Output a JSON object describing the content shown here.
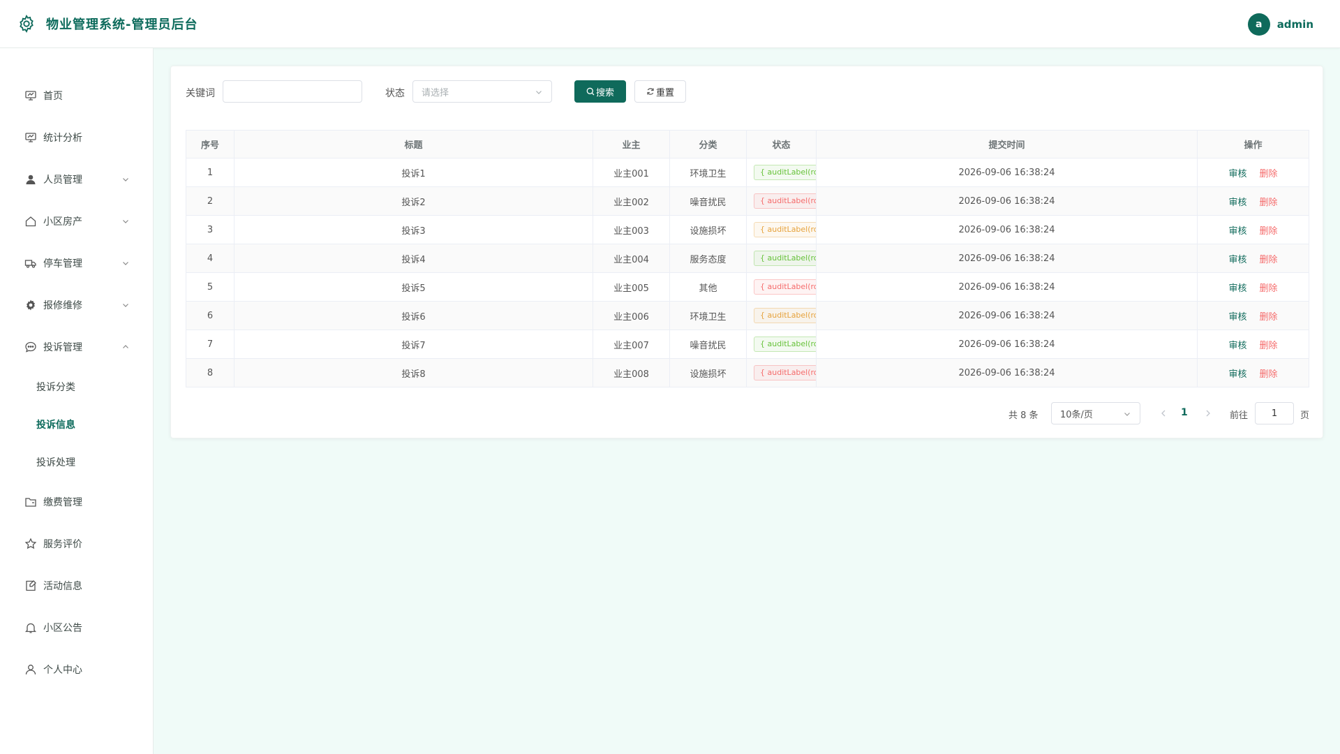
{
  "header": {
    "title": "物业管理系统-管理员后台",
    "user_initial": "a",
    "user_name": "admin"
  },
  "sidebar": {
    "items": [
      {
        "label": "首页",
        "icon": "monitor-icon"
      },
      {
        "label": "统计分析",
        "icon": "chart-icon"
      },
      {
        "label": "人员管理",
        "icon": "user-icon"
      },
      {
        "label": "小区房产",
        "icon": "house-icon"
      },
      {
        "label": "停车管理",
        "icon": "truck-icon"
      },
      {
        "label": "报修维修",
        "icon": "gear-icon"
      },
      {
        "label": "投诉管理",
        "icon": "chat-icon"
      },
      {
        "label": "缴费管理",
        "icon": "folder-icon"
      },
      {
        "label": "服务评价",
        "icon": "star-icon"
      },
      {
        "label": "活动信息",
        "icon": "note-icon"
      },
      {
        "label": "小区公告",
        "icon": "bell-icon"
      },
      {
        "label": "个人中心",
        "icon": "person-icon"
      }
    ],
    "sub_items": [
      "投诉分类",
      "投诉信息",
      "投诉处理"
    ]
  },
  "filter": {
    "keyword_label": "关键词",
    "keyword_value": "",
    "status_label": "状态",
    "status_placeholder": "请选择",
    "search_label": "搜索",
    "reset_label": "重置"
  },
  "table": {
    "headers": [
      "序号",
      "标题",
      "业主",
      "分类",
      "状态",
      "提交时间",
      "操作"
    ],
    "rows": [
      {
        "no": "1",
        "title": "投诉1",
        "owner": "业主001",
        "category": "环境卫生",
        "status": "{ auditLabel(row",
        "status_color": "#67c23a",
        "time": "2026-09-06 16:38:24"
      },
      {
        "no": "2",
        "title": "投诉2",
        "owner": "业主002",
        "category": "噪音扰民",
        "status": "{ auditLabel(row",
        "status_color": "#f56c6c",
        "time": "2026-09-06 16:38:24"
      },
      {
        "no": "3",
        "title": "投诉3",
        "owner": "业主003",
        "category": "设施损坏",
        "status": "{ auditLabel(row",
        "status_color": "#e6a23c",
        "time": "2026-09-06 16:38:24"
      },
      {
        "no": "4",
        "title": "投诉4",
        "owner": "业主004",
        "category": "服务态度",
        "status": "{ auditLabel(row",
        "status_color": "#67c23a",
        "time": "2026-09-06 16:38:24"
      },
      {
        "no": "5",
        "title": "投诉5",
        "owner": "业主005",
        "category": "其他",
        "status": "{ auditLabel(row",
        "status_color": "#f56c6c",
        "time": "2026-09-06 16:38:24"
      },
      {
        "no": "6",
        "title": "投诉6",
        "owner": "业主006",
        "category": "环境卫生",
        "status": "{ auditLabel(row",
        "status_color": "#e6a23c",
        "time": "2026-09-06 16:38:24"
      },
      {
        "no": "7",
        "title": "投诉7",
        "owner": "业主007",
        "category": "噪音扰民",
        "status": "{ auditLabel(row",
        "status_color": "#67c23a",
        "time": "2026-09-06 16:38:24"
      },
      {
        "no": "8",
        "title": "投诉8",
        "owner": "业主008",
        "category": "设施损坏",
        "status": "{ auditLabel(row",
        "status_color": "#f56c6c",
        "time": "2026-09-06 16:38:24"
      }
    ],
    "op_audit": "审核",
    "op_delete": "删除"
  },
  "pagination": {
    "total_text": "共 8 条",
    "page_size": "10条/页",
    "current_page": "1",
    "goto_label": "前往",
    "goto_value": "1",
    "page_suffix": "页"
  },
  "colors": {
    "brand": "#0f6a5b",
    "delete": "#f56c6c"
  }
}
